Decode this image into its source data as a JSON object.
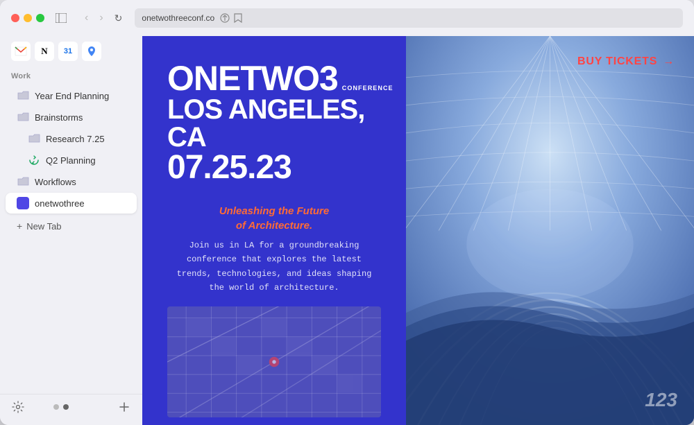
{
  "window": {
    "title": "onetwothreeconf.co",
    "url": "onetwothreeconf.co"
  },
  "nav": {
    "back_label": "‹",
    "forward_label": "›",
    "refresh_label": "↻"
  },
  "sidebar": {
    "section_label": "Work",
    "items": [
      {
        "id": "year-end-planning",
        "label": "Year End Planning",
        "icon": "folder",
        "level": 0
      },
      {
        "id": "brainstorms",
        "label": "Brainstorms",
        "icon": "folder",
        "level": 0
      },
      {
        "id": "research",
        "label": "Research 7.25",
        "icon": "folder",
        "level": 1
      },
      {
        "id": "q2-planning",
        "label": "Q2 Planning",
        "icon": "sync",
        "level": 1
      },
      {
        "id": "workflows",
        "label": "Workflows",
        "icon": "folder",
        "level": 0
      },
      {
        "id": "onetwothree",
        "label": "onetwothree",
        "icon": "square",
        "level": 0,
        "active": true
      }
    ],
    "new_tab_label": "New Tab",
    "app_icons": [
      "M",
      "N",
      "31",
      "+"
    ]
  },
  "conference": {
    "conference_label": "CONFERENCE",
    "title_line1": "ONETWO3",
    "title_line2": "LOS ANGELES, CA",
    "title_line3": "07.25.23",
    "tagline_line1": "Unleashing the Future",
    "tagline_line2": "of Architecture.",
    "description": "Join us in LA for a groundbreaking conference that explores the latest trends, technologies, and ideas shaping the world of architecture.",
    "buy_tickets": "BUY TICKETS",
    "arrow": "→",
    "watermark": "123"
  }
}
